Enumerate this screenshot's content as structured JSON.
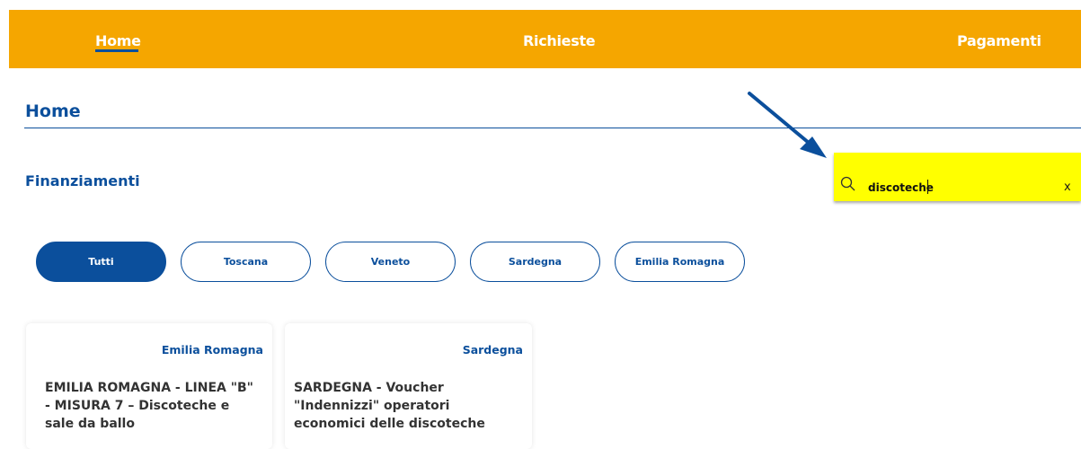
{
  "nav": {
    "items": [
      {
        "label": "Home"
      },
      {
        "label": "Richieste"
      },
      {
        "label": "Pagamenti"
      }
    ],
    "active_color": "#0b4f9c",
    "background": "#f5a600"
  },
  "page": {
    "title": "Home",
    "section_title": "Finanziamenti"
  },
  "search": {
    "value": "discoteche",
    "clear_label": "x",
    "highlight_color": "#ffff00"
  },
  "filters": [
    {
      "label": "Tutti",
      "active": true
    },
    {
      "label": "Toscana",
      "active": false
    },
    {
      "label": "Veneto",
      "active": false
    },
    {
      "label": "Sardegna",
      "active": false
    },
    {
      "label": "Emilia Romagna",
      "active": false
    }
  ],
  "cards": [
    {
      "region": "Emilia Romagna",
      "lines": [
        "EMILIA ROMAGNA - LINEA \"B\"",
        "- MISURA 7 – Discoteche e",
        "sale da ballo"
      ]
    },
    {
      "region": "Sardegna",
      "lines": [
        "SARDEGNA - Voucher",
        "\"Indennizzi\" operatori",
        "economici delle discoteche"
      ]
    }
  ]
}
